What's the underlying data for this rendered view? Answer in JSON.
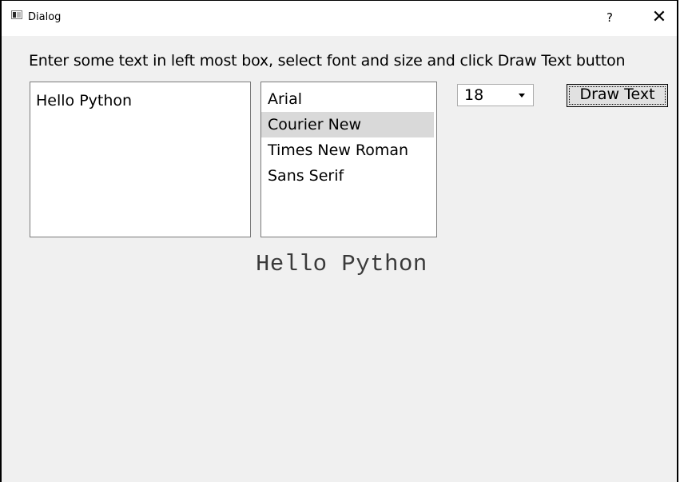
{
  "window": {
    "title": "Dialog",
    "help_label": "?",
    "close_label": "✕"
  },
  "instruction": "Enter some text in left most box, select font and size and click Draw Text button",
  "text_input": {
    "value": "Hello Python"
  },
  "font_list": {
    "items": [
      "Arial",
      "Courier New",
      "Times New Roman",
      "Sans Serif"
    ],
    "selected": "Courier New"
  },
  "size_combo": {
    "value": "18"
  },
  "draw_button": {
    "label": "Draw Text"
  },
  "output": {
    "text": "Hello Python"
  },
  "colors": {
    "window_background": "#f0f0f0",
    "selection": "#d9d9d9"
  },
  "icons": {
    "app": "app-window-icon",
    "dropdown": "chevron-down-icon"
  }
}
